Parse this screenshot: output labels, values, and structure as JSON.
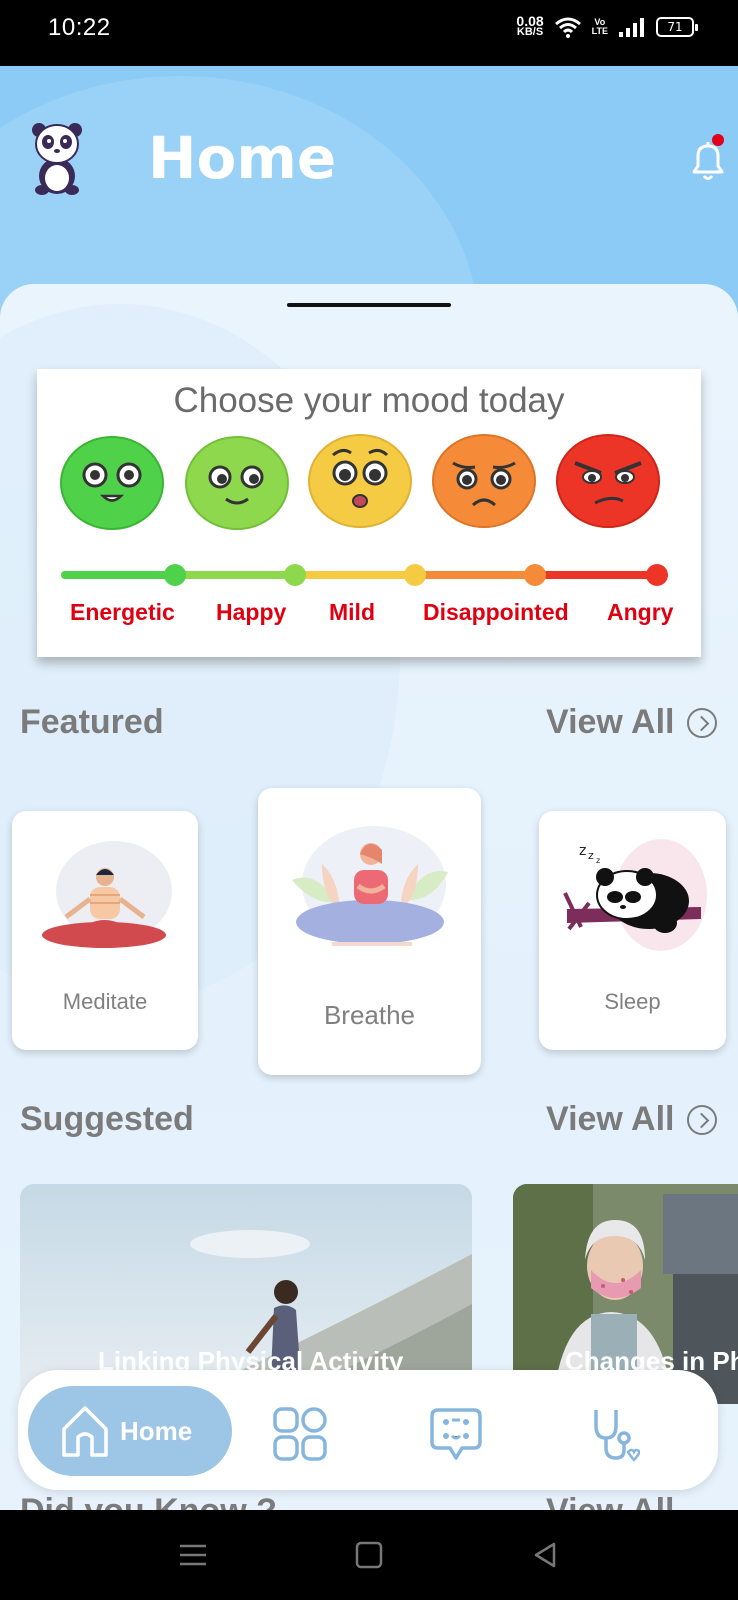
{
  "status_bar": {
    "time": "10:22",
    "net_speed_value": "0.08",
    "net_speed_unit": "KB/S",
    "volte_top": "Vo",
    "volte_bottom": "LTE",
    "battery": "71"
  },
  "header": {
    "title": "Home",
    "logo_icon": "panda-logo-icon",
    "notification_icon": "bell-icon",
    "has_unread": true
  },
  "mood": {
    "title": "Choose your mood today",
    "options": [
      {
        "label": "Energetic",
        "color": "#4fd14a"
      },
      {
        "label": "Happy",
        "color": "#8ed84e"
      },
      {
        "label": "Mild",
        "color": "#f6cb44"
      },
      {
        "label": "Disappointed",
        "color": "#f58a38"
      },
      {
        "label": "Angry",
        "color": "#ec3526"
      }
    ]
  },
  "featured": {
    "title": "Featured",
    "view_all": "View All",
    "items": [
      {
        "label": "Meditate"
      },
      {
        "label": "Breathe"
      },
      {
        "label": "Sleep"
      }
    ]
  },
  "suggested": {
    "title": "Suggested",
    "view_all": "View All",
    "items": [
      {
        "caption": "Linking Physical Activity"
      },
      {
        "caption": "Changes in Ph"
      }
    ]
  },
  "did_you_know": {
    "title": "Did you Know ?",
    "view_all": "View All"
  },
  "tab_bar": {
    "home_label": "Home",
    "active_color": "#9cc5e6",
    "icon_color": "#86b6de"
  }
}
